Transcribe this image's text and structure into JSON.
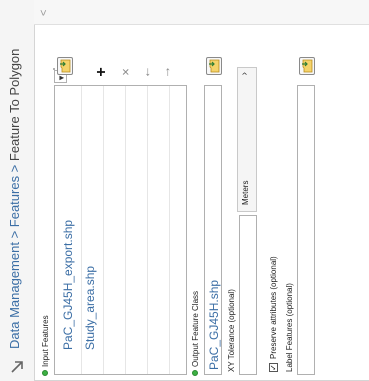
{
  "breadcrumb": {
    "path": "Data Management > Features > ",
    "current": "Feature To Polygon"
  },
  "input_features": {
    "label": "Input Features",
    "items": [
      "PaC_GJ45H_export.shp",
      "Study_area.shp"
    ]
  },
  "output_feature_class": {
    "label": "Output Feature Class",
    "value": "PaC_GJ45H.shp"
  },
  "xy_tolerance": {
    "label": "XY Tolerance (optional)",
    "value": "",
    "unit": "Meters"
  },
  "preserve_attributes": {
    "label": "Preserve attributes (optional)",
    "checked": true
  },
  "label_features": {
    "label": "Label Features (optional)",
    "value": ""
  },
  "toolbar": {
    "add": "+",
    "remove": "×",
    "move_up": "←",
    "move_down": "→"
  },
  "scroll_up_glyph": "<"
}
